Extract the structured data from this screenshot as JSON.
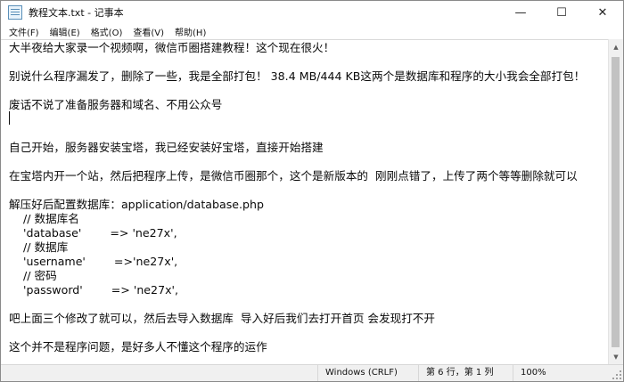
{
  "window": {
    "title": "教程文本.txt - 记事本",
    "minimize_glyph": "—",
    "maximize_glyph": "☐",
    "close_glyph": "✕"
  },
  "menu": {
    "file": "文件(F)",
    "edit": "编辑(E)",
    "format": "格式(O)",
    "view": "查看(V)",
    "help": "帮助(H)"
  },
  "editor": {
    "lines": [
      "大半夜给大家录一个视频啊，微信币圈搭建教程！这个现在很火！",
      "",
      "别说什么程序漏发了，删除了一些，我是全部打包！ 38.4 MB/444 KB这两个是数据库和程序的大小我会全部打包！",
      "",
      "废话不说了准备服务器和域名、不用公众号",
      "",
      "",
      "自己开始，服务器安装宝塔，我已经安装好宝塔，直接开始搭建",
      "",
      "在宝塔内开一个站，然后把程序上传，是微信币圈那个，这个是新版本的  刚刚点错了，上传了两个等等删除就可以",
      "",
      "解压好后配置数据库：application/database.php",
      "    // 数据库名",
      "    'database'        => 'ne27x',",
      "    // 数据库",
      "    'username'        =>'ne27x',",
      "    // 密码",
      "    'password'        => 'ne27x',",
      "",
      "吧上面三个修改了就可以，然后去导入数据库  导入好后我们去打开首页 会发现打不开",
      "",
      "这个并不是程序问题，是好多人不懂这个程序的运作"
    ]
  },
  "scrollbar": {
    "up_glyph": "▲",
    "down_glyph": "▼"
  },
  "status": {
    "line_ending": "Windows (CRLF)",
    "position": "第 6 行，第 1 列",
    "zoom": "100%"
  }
}
